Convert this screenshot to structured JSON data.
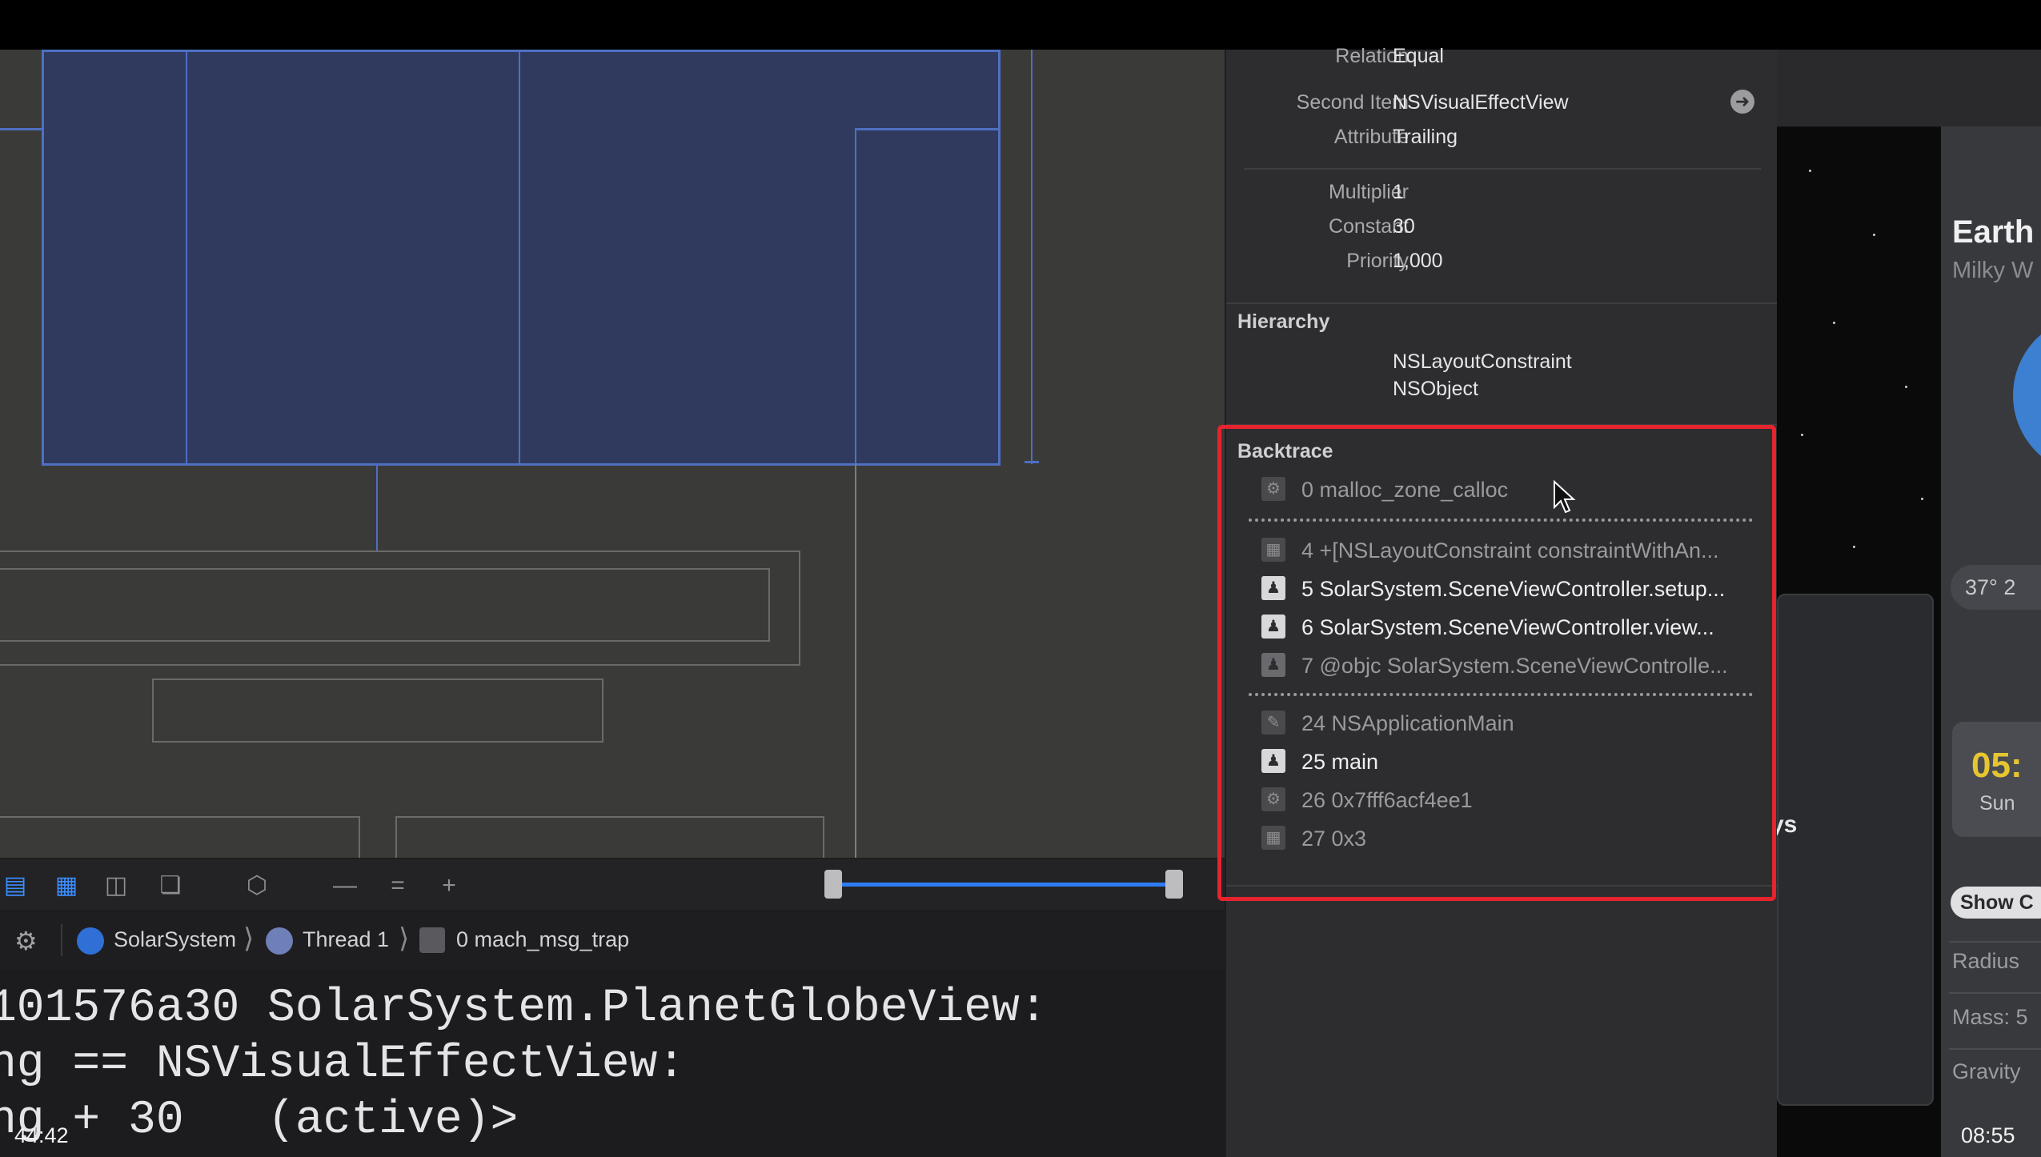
{
  "inspector": {
    "fields": [
      {
        "label": "Relation",
        "value": "Equal"
      },
      {
        "label": "Second Item",
        "value": "NSVisualEffectView"
      },
      {
        "label": "Attribute",
        "value": "Trailing"
      },
      {
        "label": "Multiplier",
        "value": "1"
      },
      {
        "label": "Constant",
        "value": "30"
      },
      {
        "label": "Priority",
        "value": "1,000"
      }
    ],
    "hierarchy_title": "Hierarchy",
    "hierarchy": [
      "NSLayoutConstraint",
      "NSObject"
    ],
    "backtrace_title": "Backtrace",
    "backtrace": [
      {
        "text": "0 malloc_zone_calloc",
        "icon": "gear-icon"
      },
      {
        "text": "4 +[NSLayoutConstraint constraintWithAn...",
        "icon": "framework-icon"
      },
      {
        "text": "5 SolarSystem.SceneViewController.setup...",
        "icon": "user-icon"
      },
      {
        "text": "6 SolarSystem.SceneViewController.view...",
        "icon": "user-icon"
      },
      {
        "text": "7 @objc SolarSystem.SceneViewControlle...",
        "icon": "user-icon"
      },
      {
        "text": "24 NSApplicationMain",
        "icon": "appkit-icon"
      },
      {
        "text": "25 main",
        "icon": "user-icon"
      },
      {
        "text": "26 0x7fff6acf4ee1",
        "icon": "gear-icon"
      },
      {
        "text": "27 0x3",
        "icon": "framework-icon"
      }
    ]
  },
  "toolbar": {
    "icons": [
      "stack-view-icon",
      "embed-icon",
      "align-icon",
      "resolve-icon",
      "update-frames-icon",
      "remove-icon",
      "equal-icon",
      "add-icon"
    ]
  },
  "breadcrumb": {
    "items": [
      "SolarSystem",
      "Thread 1",
      "0 mach_msg_trap"
    ]
  },
  "console": {
    "lines": [
      "101576a30 SolarSystem.PlanetGlobeView:",
      "ng == NSVisualEffectView:",
      "ng + 30   (active)>"
    ]
  },
  "app": {
    "title": "Earth",
    "subtitle": "Milky W",
    "coord": "37° 2",
    "time": "05:",
    "time_sub": "Sun",
    "show_button": "Show C",
    "stats": [
      "Radius",
      "Mass: 5",
      "Gravity"
    ],
    "days_label": "ys"
  },
  "timestamps": {
    "left": "44:42",
    "right": "08:55"
  },
  "colors": {
    "highlight": "#e5242e",
    "accent": "#2f7df5",
    "time_yellow": "#e6c630"
  }
}
